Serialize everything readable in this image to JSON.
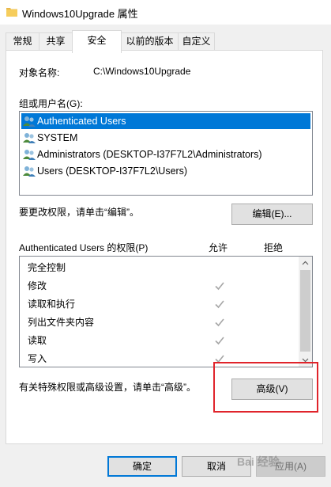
{
  "window": {
    "title": "Windows10Upgrade 属性"
  },
  "tabs": [
    {
      "label": "常规",
      "active": false
    },
    {
      "label": "共享",
      "active": false
    },
    {
      "label": "安全",
      "active": true
    },
    {
      "label": "以前的版本",
      "active": false
    },
    {
      "label": "自定义",
      "active": false
    }
  ],
  "object": {
    "label": "对象名称:",
    "value": "C:\\Windows10Upgrade"
  },
  "group": {
    "label": "组或用户名(G):",
    "items": [
      {
        "label": "Authenticated Users",
        "selected": true
      },
      {
        "label": "SYSTEM",
        "selected": false
      },
      {
        "label": "Administrators (DESKTOP-I37F7L2\\Administrators)",
        "selected": false
      },
      {
        "label": "Users (DESKTOP-I37F7L2\\Users)",
        "selected": false
      }
    ]
  },
  "change_hint": "要更改权限，请单击“编辑”。",
  "edit_button": "编辑(E)...",
  "permissions": {
    "label": "Authenticated Users 的权限(P)",
    "allow_header": "允许",
    "deny_header": "拒绝",
    "rows": [
      {
        "label": "完全控制",
        "allow": false
      },
      {
        "label": "修改",
        "allow": true
      },
      {
        "label": "读取和执行",
        "allow": true
      },
      {
        "label": "列出文件夹内容",
        "allow": true
      },
      {
        "label": "读取",
        "allow": true
      },
      {
        "label": "写入",
        "allow": true
      }
    ]
  },
  "special_hint": "有关特殊权限或高级设置，请单击“高级”。",
  "advanced_button": "高级(V)",
  "footer": {
    "ok": "确定",
    "cancel": "取消",
    "apply": "应用(A)"
  },
  "watermark": "Bai 经验",
  "colors": {
    "selection": "#0078d7",
    "highlight_box": "#e0242b"
  }
}
